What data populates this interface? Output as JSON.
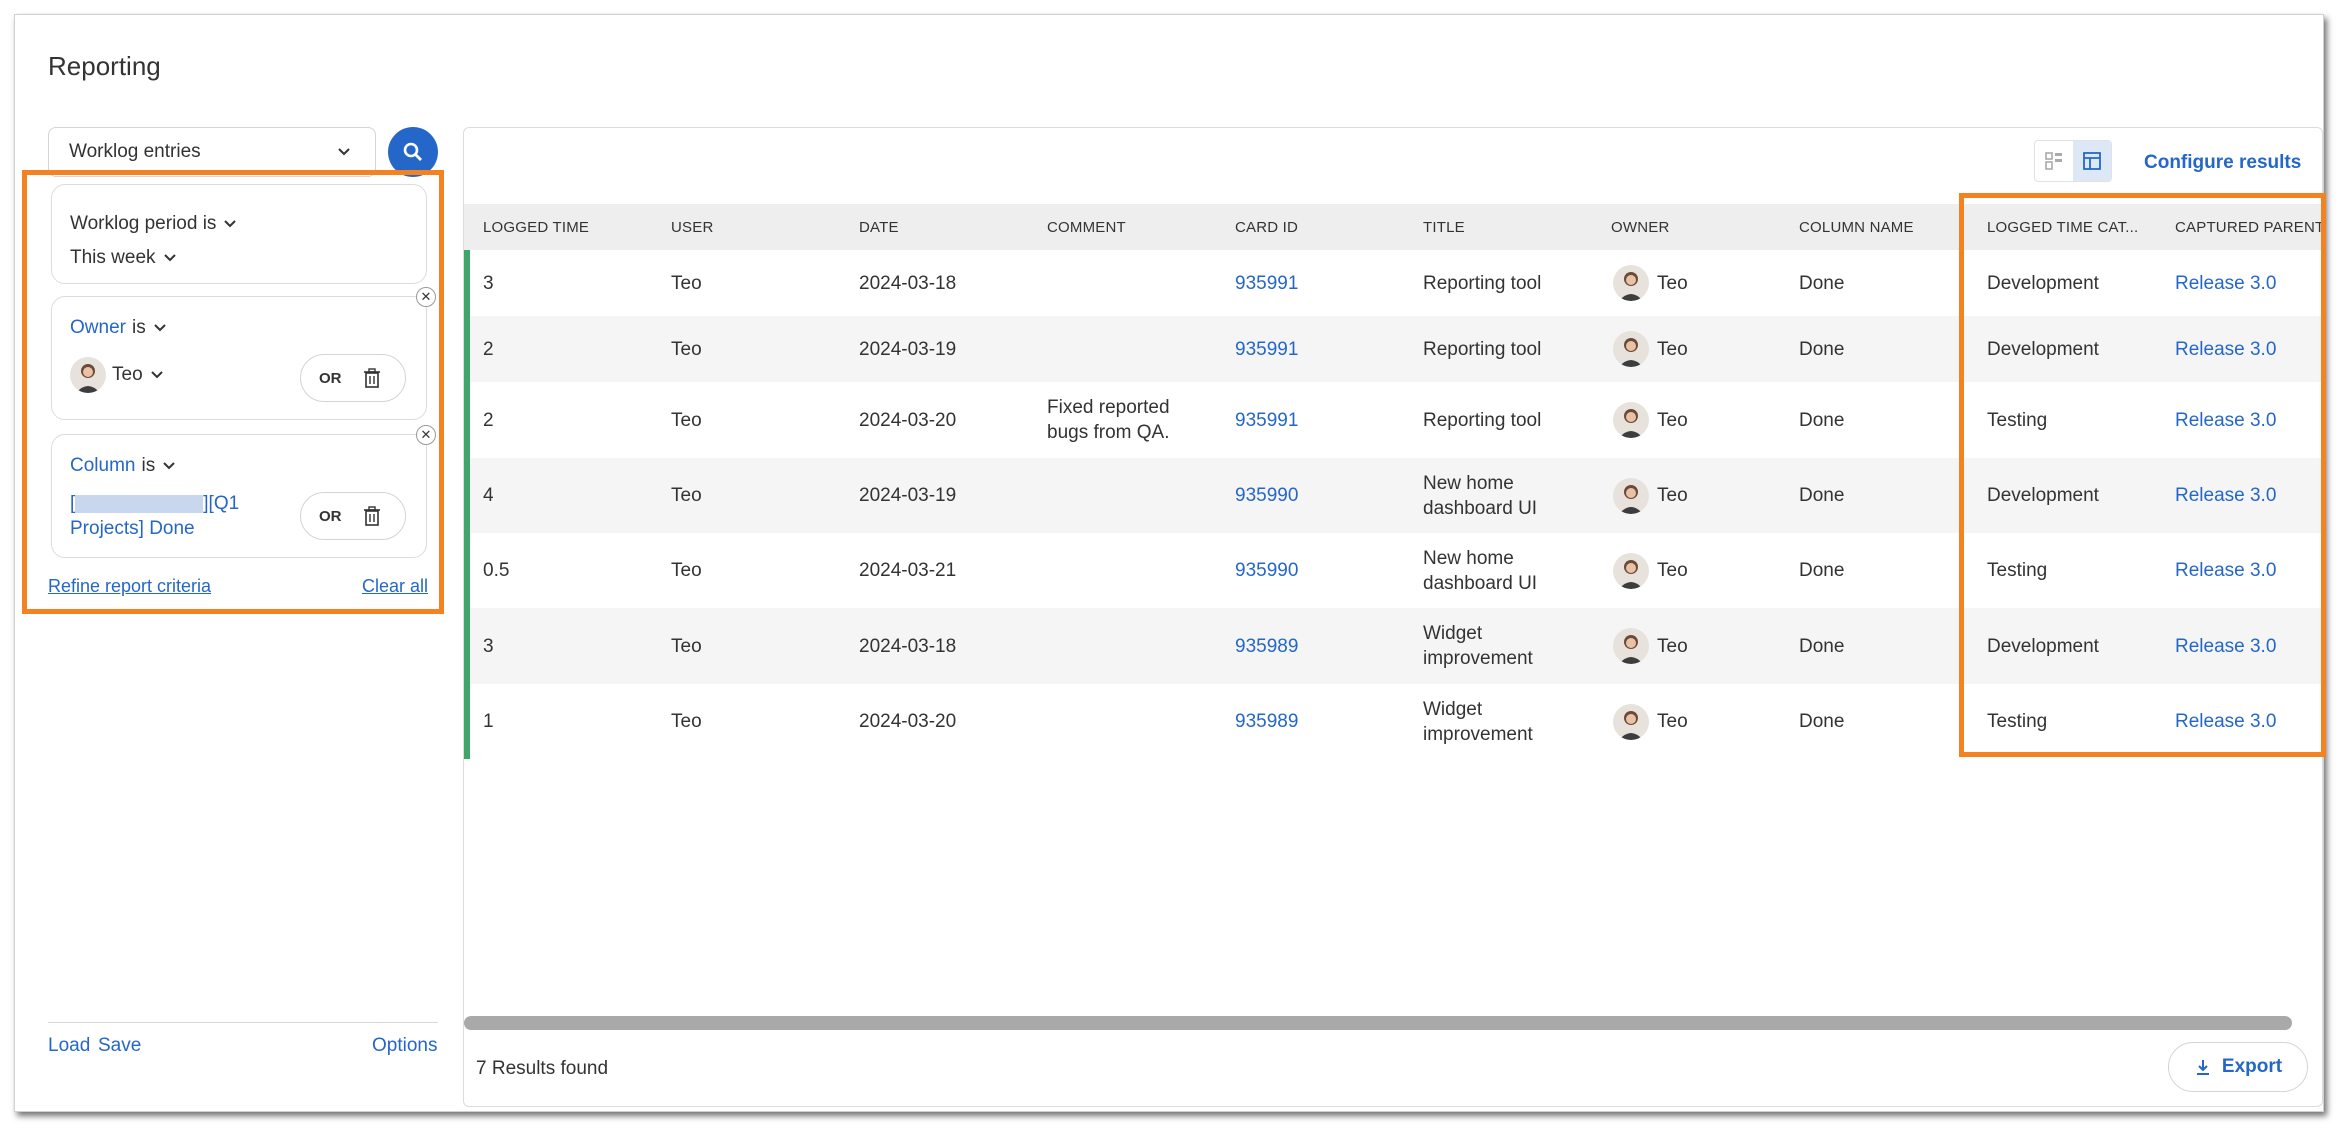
{
  "page": {
    "title": "Reporting"
  },
  "query": {
    "type_label": "Worklog entries"
  },
  "filters": {
    "period": {
      "label": "Worklog period is",
      "value": "This week"
    },
    "owner": {
      "field": "Owner",
      "op": "is",
      "value": "Teo",
      "or_label": "OR"
    },
    "column": {
      "field": "Column",
      "op": "is",
      "value_line1": "[",
      "value_blur": "xxxxxxxxxx",
      "value_line1b": "][Q1",
      "value_line2": "Projects] Done",
      "or_label": "OR"
    },
    "refine_label": "Refine report criteria",
    "clear_label": "Clear all"
  },
  "footer_left": {
    "load": "Load",
    "save": "Save",
    "options": "Options"
  },
  "results": {
    "configure_label": "Configure results",
    "columns": [
      "LOGGED TIME",
      "USER",
      "DATE",
      "COMMENT",
      "CARD ID",
      "TITLE",
      "OWNER",
      "COLUMN NAME",
      "LOGGED TIME CAT...",
      "CAPTURED PARENT"
    ],
    "rows": [
      {
        "logged": "3",
        "user": "Teo",
        "date": "2024-03-18",
        "comment": [
          "",
          ""
        ],
        "card": "935991",
        "title": [
          "Reporting tool",
          ""
        ],
        "owner": "Teo",
        "column": "Done",
        "category": "Development",
        "parent": "Release 3.0"
      },
      {
        "logged": "2",
        "user": "Teo",
        "date": "2024-03-19",
        "comment": [
          "",
          ""
        ],
        "card": "935991",
        "title": [
          "Reporting tool",
          ""
        ],
        "owner": "Teo",
        "column": "Done",
        "category": "Development",
        "parent": "Release 3.0"
      },
      {
        "logged": "2",
        "user": "Teo",
        "date": "2024-03-20",
        "comment": [
          "Fixed reported",
          "bugs from QA."
        ],
        "card": "935991",
        "title": [
          "Reporting tool",
          ""
        ],
        "owner": "Teo",
        "column": "Done",
        "category": "Testing",
        "parent": "Release 3.0"
      },
      {
        "logged": "4",
        "user": "Teo",
        "date": "2024-03-19",
        "comment": [
          "",
          ""
        ],
        "card": "935990",
        "title": [
          "New home",
          "dashboard UI"
        ],
        "owner": "Teo",
        "column": "Done",
        "category": "Development",
        "parent": "Release 3.0"
      },
      {
        "logged": "0.5",
        "user": "Teo",
        "date": "2024-03-21",
        "comment": [
          "",
          ""
        ],
        "card": "935990",
        "title": [
          "New home",
          "dashboard UI"
        ],
        "owner": "Teo",
        "column": "Done",
        "category": "Testing",
        "parent": "Release 3.0"
      },
      {
        "logged": "3",
        "user": "Teo",
        "date": "2024-03-18",
        "comment": [
          "",
          ""
        ],
        "card": "935989",
        "title": [
          "Widget",
          "improvement"
        ],
        "owner": "Teo",
        "column": "Done",
        "category": "Development",
        "parent": "Release 3.0"
      },
      {
        "logged": "1",
        "user": "Teo",
        "date": "2024-03-20",
        "comment": [
          "",
          ""
        ],
        "card": "935989",
        "title": [
          "Widget",
          "improvement"
        ],
        "owner": "Teo",
        "column": "Done",
        "category": "Testing",
        "parent": "Release 3.0"
      }
    ],
    "count_label": "7 Results found",
    "export_label": "Export"
  },
  "colors": {
    "accent": "#2567c8",
    "highlight": "#f58220",
    "row_marker": "#3fa56b"
  }
}
